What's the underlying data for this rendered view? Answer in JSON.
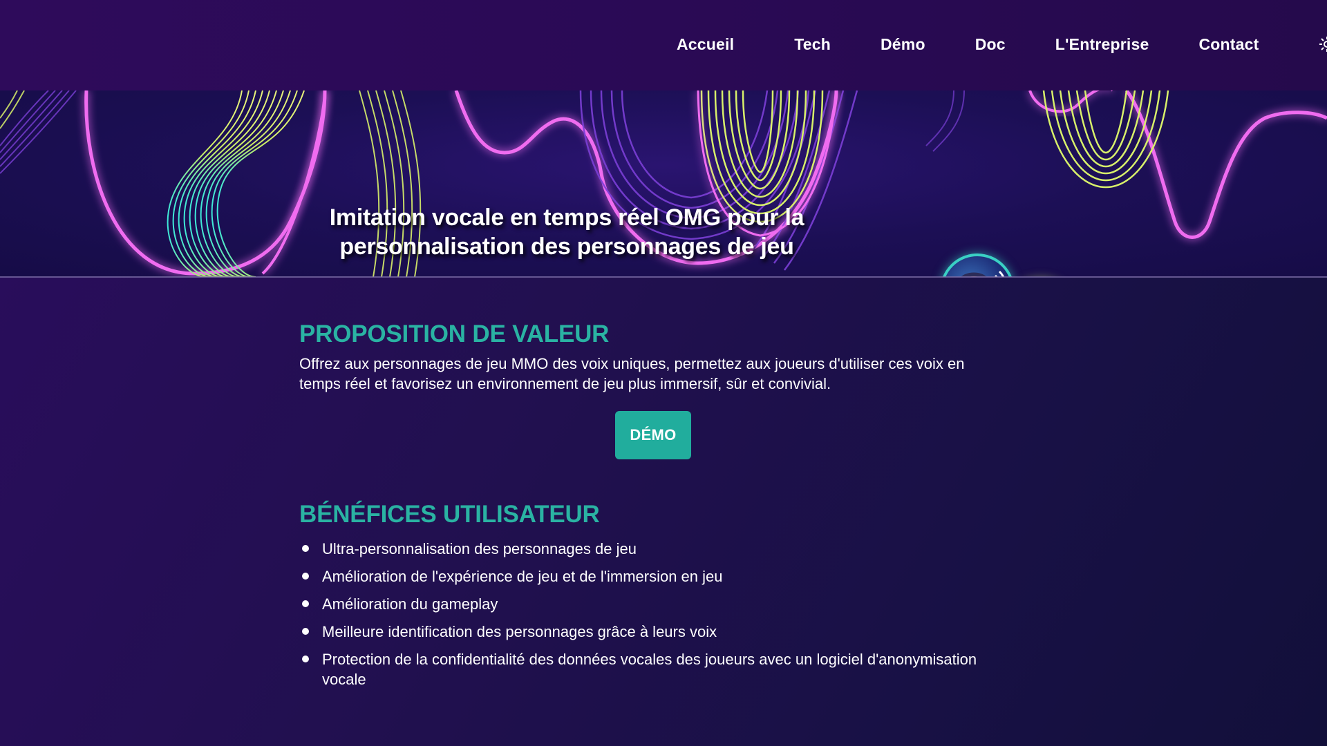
{
  "nav": {
    "items": [
      {
        "label": "Accueil"
      },
      {
        "label": "Tech"
      },
      {
        "label": "Démo"
      },
      {
        "label": "Doc"
      },
      {
        "label": "L'Entreprise"
      },
      {
        "label": "Contact"
      }
    ],
    "overflow_icon": "sun-icon"
  },
  "hero": {
    "title": "Imitation vocale en temps réel OMG pour la personnalisation des personnages de jeu",
    "avatars": [
      "gamer-headset-avatar",
      "bearded-gamer-avatar"
    ]
  },
  "value_section": {
    "title": "PROPOSITION DE VALEUR",
    "text": "Offrez aux personnages de jeu MMO des voix uniques, permettez aux joueurs d'utiliser ces voix en temps réel et favorisez un environnement de jeu plus immersif, sûr et convivial.",
    "demo_button": "DÉMO"
  },
  "benefits_section": {
    "title": "BÉNÉFICES UTILISATEUR",
    "items": [
      "Ultra-personnalisation des personnages de jeu",
      "Amélioration de l'expérience de jeu et de l'immersion en jeu",
      "Amélioration du gameplay",
      "Meilleure identification des personnages grâce à leurs voix",
      "Protection de la confidentialité des données vocales des joueurs avec un logiciel d'anonymisation vocale"
    ]
  },
  "colors": {
    "accent": "#2ab3a3",
    "button": "#21ad9d",
    "background": "#21104f",
    "neon_pink": "#e98af5",
    "neon_lime": "#d8f06a",
    "neon_cyan": "#3ee8d8"
  }
}
